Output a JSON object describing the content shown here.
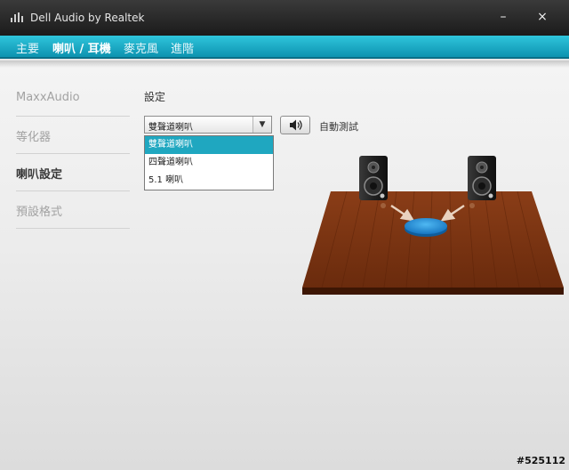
{
  "window": {
    "title": "Dell Audio by Realtek",
    "minimize_label": "–",
    "close_label": "×"
  },
  "nav": {
    "tabs": [
      {
        "label": "主要",
        "active": false
      },
      {
        "label": "喇叭 / 耳機",
        "active": true
      },
      {
        "label": "麥克風",
        "active": false
      },
      {
        "label": "進階",
        "active": false
      }
    ]
  },
  "sidebar": {
    "items": [
      {
        "label": "MaxxAudio",
        "active": false
      },
      {
        "label": "等化器",
        "active": false
      },
      {
        "label": "喇叭設定",
        "active": true
      },
      {
        "label": "預設格式",
        "active": false
      }
    ]
  },
  "settings": {
    "title": "設定",
    "config_select": {
      "value": "雙聲道喇叭",
      "options": [
        "雙聲道喇叭",
        "四聲道喇叭",
        "5.1 喇叭"
      ],
      "highlighted_index": 0
    },
    "test_button_icon": "speaker-volume-icon",
    "auto_test_label": "自動測試"
  },
  "diagram": {
    "floor_color": "#7a3412",
    "listener_color": "#1f8fd6",
    "speaker_count": 2
  },
  "watermark": "#525112"
}
